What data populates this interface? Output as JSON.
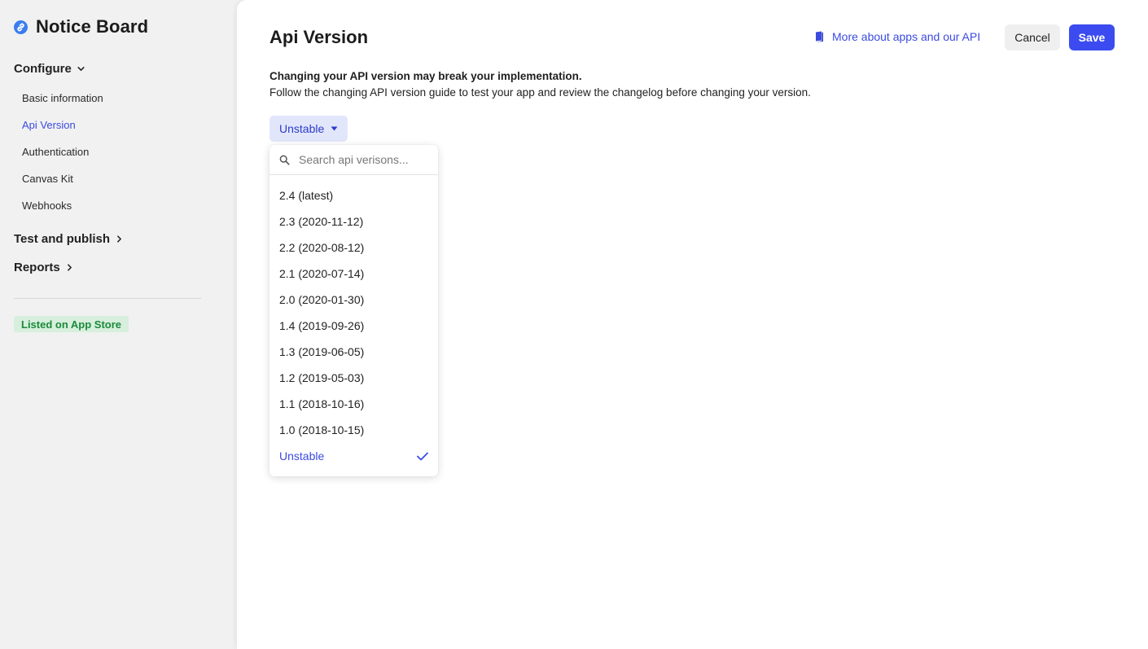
{
  "sidebar": {
    "app_title": "Notice Board",
    "brand_icon": "link-icon",
    "sections": {
      "configure": {
        "label": "Configure",
        "expanded": true,
        "items": [
          {
            "label": "Basic information",
            "active": false
          },
          {
            "label": "Api Version",
            "active": true
          },
          {
            "label": "Authentication",
            "active": false
          },
          {
            "label": "Canvas Kit",
            "active": false
          },
          {
            "label": "Webhooks",
            "active": false
          }
        ]
      },
      "test_publish": {
        "label": "Test and publish",
        "expanded": false
      },
      "reports": {
        "label": "Reports",
        "expanded": false
      }
    },
    "status_badge": "Listed on App Store"
  },
  "header": {
    "title": "Api Version",
    "help_link": "More about apps and our API",
    "cancel_label": "Cancel",
    "save_label": "Save"
  },
  "description": {
    "line1": "Changing your API version may break your implementation.",
    "line2": "Follow the changing API version guide to test your app and review the changelog before changing your version."
  },
  "version_select": {
    "current": "Unstable",
    "search_placeholder": "Search api verisons...",
    "options": [
      {
        "label": "2.4 (latest)",
        "selected": false
      },
      {
        "label": "2.3 (2020-11-12)",
        "selected": false
      },
      {
        "label": "2.2 (2020-08-12)",
        "selected": false
      },
      {
        "label": "2.1 (2020-07-14)",
        "selected": false
      },
      {
        "label": "2.0 (2020-01-30)",
        "selected": false
      },
      {
        "label": "1.4 (2019-09-26)",
        "selected": false
      },
      {
        "label": "1.3 (2019-06-05)",
        "selected": false
      },
      {
        "label": "1.2 (2019-05-03)",
        "selected": false
      },
      {
        "label": "1.1 (2018-10-16)",
        "selected": false
      },
      {
        "label": "1.0 (2018-10-15)",
        "selected": false
      },
      {
        "label": "Unstable",
        "selected": true
      }
    ]
  },
  "colors": {
    "accent": "#3b4bf0",
    "link": "#3b4be0",
    "badge_bg": "#d7efdc",
    "badge_text": "#1b8a3c"
  }
}
